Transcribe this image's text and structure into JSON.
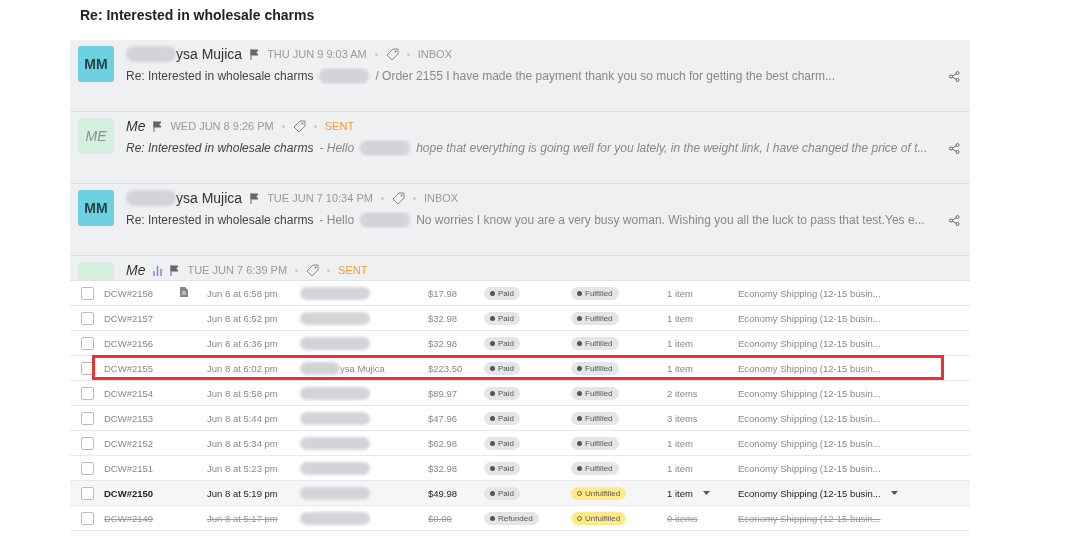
{
  "thread_title": "Re: Interested in wholesale charms",
  "emails": [
    {
      "avatar": "MM",
      "from_me": false,
      "sender_parts": [
        {
          "kind": "redacted"
        },
        {
          "kind": "text",
          "text": "ysa Mujica"
        }
      ],
      "tracked": false,
      "date": "THU JUN 9 9:03 AM",
      "folder": "INBOX",
      "subject": "Re: Interested in wholesale charms",
      "preview_parts": [
        {
          "kind": "redacted"
        },
        {
          "kind": "text",
          "text": "/ Order 2155 I have made the payment thank you so much for getting the best charm..."
        }
      ]
    },
    {
      "avatar": "ME",
      "from_me": true,
      "sender_parts": [
        {
          "kind": "text",
          "text": "Me"
        }
      ],
      "tracked": false,
      "date": "WED JUN 8 9:26 PM",
      "folder": "SENT",
      "subject": "Re: Interested in wholesale charms",
      "preview_parts": [
        {
          "kind": "text",
          "text": "- Hello"
        },
        {
          "kind": "redacted"
        },
        {
          "kind": "text",
          "text": "hope that everything is going well for you lately, in the weight link, I have changed the price of t..."
        }
      ]
    },
    {
      "avatar": "MM",
      "from_me": false,
      "sender_parts": [
        {
          "kind": "redacted"
        },
        {
          "kind": "text",
          "text": "ysa Mujica"
        }
      ],
      "tracked": false,
      "date": "TUE JUN 7 10:34 PM",
      "folder": "INBOX",
      "subject": "Re: Interested in wholesale charms",
      "preview_parts": [
        {
          "kind": "text",
          "text": "- Hello"
        },
        {
          "kind": "redacted"
        },
        {
          "kind": "text",
          "text": "No worries I know you are a very busy woman. Wishing you all the luck to pass that test.Yes e..."
        }
      ]
    },
    {
      "from_me": true,
      "sender_parts": [
        {
          "kind": "text",
          "text": "Me"
        }
      ],
      "tracked": true,
      "date": "TUE JUN 7 6:39 PM",
      "folder": "SENT"
    }
  ],
  "orders": [
    {
      "kind": "done",
      "checked": false,
      "highlighted": false,
      "order": "DCW#2158",
      "note": true,
      "date": "Jun 8 at 6:58 pm",
      "total": "$17.98",
      "payment": "Paid",
      "fulfillment": "Fulfilled",
      "fulfilled": true,
      "items": "1 item",
      "shipping": "Economy Shipping (12-15 busin..."
    },
    {
      "kind": "done",
      "checked": false,
      "highlighted": false,
      "order": "DCW#2157",
      "note": false,
      "date": "Jun 8 at 6:52 pm",
      "total": "$32.98",
      "payment": "Paid",
      "fulfillment": "Fulfilled",
      "fulfilled": true,
      "items": "1 item",
      "shipping": "Economy Shipping (12-15 busin..."
    },
    {
      "kind": "done",
      "checked": false,
      "highlighted": false,
      "order": "DCW#2156",
      "note": false,
      "date": "Jun 8 at 6:36 pm",
      "total": "$32.98",
      "payment": "Paid",
      "fulfillment": "Fulfilled",
      "fulfilled": true,
      "items": "1 item",
      "shipping": "Economy Shipping (12-15 busin..."
    },
    {
      "kind": "done",
      "checked": false,
      "highlighted": true,
      "order": "DCW#2155",
      "note": false,
      "date": "Jun 8 at 6:02 pm",
      "customer": "ysa Mujica",
      "total": "$223.50",
      "payment": "Paid",
      "fulfillment": "Fulfilled",
      "fulfilled": true,
      "items": "1 item",
      "shipping": "Economy Shipping (12-15 busin..."
    },
    {
      "kind": "done",
      "checked": false,
      "highlighted": false,
      "order": "DCW#2154",
      "note": false,
      "date": "Jun 8 at 5:58 pm",
      "total": "$89.97",
      "payment": "Paid",
      "fulfillment": "Fulfilled",
      "fulfilled": true,
      "items": "2 items",
      "shipping": "Economy Shipping (12-15 busin..."
    },
    {
      "kind": "done",
      "checked": false,
      "highlighted": false,
      "order": "DCW#2153",
      "note": false,
      "date": "Jun 8 at 5:44 pm",
      "total": "$47.96",
      "payment": "Paid",
      "fulfillment": "Fulfilled",
      "fulfilled": true,
      "items": "3 items",
      "shipping": "Economy Shipping (12-15 busin..."
    },
    {
      "kind": "done",
      "checked": false,
      "highlighted": false,
      "order": "DCW#2152",
      "note": false,
      "date": "Jun 8 at 5:34 pm",
      "total": "$62.98",
      "payment": "Paid",
      "fulfillment": "Fulfilled",
      "fulfilled": true,
      "items": "1 item",
      "shipping": "Economy Shipping (12-15 busin..."
    },
    {
      "kind": "done",
      "checked": false,
      "highlighted": false,
      "order": "DCW#2151",
      "note": false,
      "date": "Jun 8 at 5:23 pm",
      "total": "$32.98",
      "payment": "Paid",
      "fulfillment": "Fulfilled",
      "fulfilled": true,
      "items": "1 item",
      "shipping": "Economy Shipping (12-15 busin..."
    },
    {
      "kind": "open",
      "checked": false,
      "highlighted": false,
      "order": "DCW#2150",
      "note": false,
      "date": "Jun 8 at 5:19 pm",
      "total": "$49.98",
      "payment": "Paid",
      "fulfillment": "Unfulfilled",
      "fulfilled": false,
      "items": "1 item",
      "shipping": "Economy Shipping (12-15 busin..."
    },
    {
      "kind": "cancelled",
      "checked": false,
      "highlighted": false,
      "order": "DCW#2149",
      "note": false,
      "date": "Jun 8 at 5:17 pm",
      "total": "$0.00",
      "payment": "Refunded",
      "fulfillment": "Unfulfilled",
      "fulfilled": false,
      "items": "0 items",
      "shipping": "Economy Shipping (12-15 busin..."
    }
  ]
}
